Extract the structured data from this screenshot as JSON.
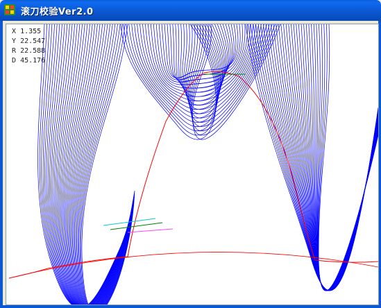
{
  "window": {
    "title": "滚刀校验Ver2.0"
  },
  "readout": [
    {
      "label": "X",
      "value": "1.355"
    },
    {
      "label": "Y",
      "value": "22.547"
    },
    {
      "label": "R",
      "value": "22.588"
    },
    {
      "label": "D",
      "value": "45.176"
    }
  ],
  "colors": {
    "profile_lines": "#0000ff",
    "tooth_profile": "#ff0000",
    "marker_green": "#008000",
    "marker_cyan": "#00cccc",
    "marker_magenta": "#ff44ff"
  }
}
